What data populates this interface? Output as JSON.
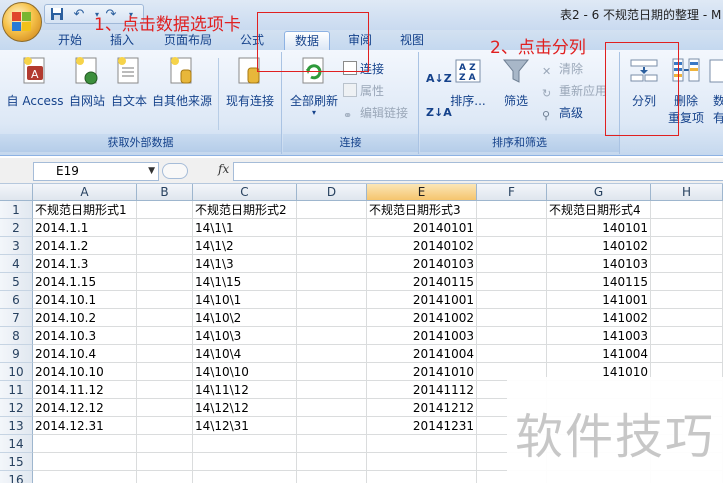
{
  "app": {
    "title": "表2 - 6 不规范日期的整理 - M"
  },
  "quick_access": {
    "icons": [
      "save-icon",
      "undo-icon",
      "redo-icon"
    ]
  },
  "tabs": [
    {
      "label": "开始",
      "active": false
    },
    {
      "label": "插入",
      "active": false
    },
    {
      "label": "页面布局",
      "active": false
    },
    {
      "label": "公式",
      "active": false
    },
    {
      "label": "数据",
      "active": true
    },
    {
      "label": "审阅",
      "active": false
    },
    {
      "label": "视图",
      "active": false
    }
  ],
  "ribbon": {
    "external_data": {
      "label": "获取外部数据",
      "buttons": [
        "自 Access",
        "自网站",
        "自文本",
        "自其他来源",
        "现有连接"
      ]
    },
    "connections": {
      "label": "连接",
      "refresh_all": "全部刷新",
      "small": [
        {
          "label": "连接",
          "enabled": true
        },
        {
          "label": "属性",
          "enabled": false
        },
        {
          "label": "编辑链接",
          "enabled": false
        }
      ]
    },
    "sort_filter": {
      "label": "排序和筛选",
      "sort": "排序...",
      "filter": "筛选",
      "small": [
        {
          "label": "清除",
          "enabled": false
        },
        {
          "label": "重新应用",
          "enabled": false
        },
        {
          "label": "高级",
          "enabled": true
        }
      ]
    },
    "data_tools": {
      "split": "分列",
      "remove_dup_line1": "删除",
      "remove_dup_line2": "重复项",
      "partial_line1": "数",
      "partial_line2": "有"
    }
  },
  "formula_bar": {
    "cell_ref": "E19",
    "fx": "fx",
    "value": ""
  },
  "columns": [
    "A",
    "B",
    "C",
    "D",
    "E",
    "F",
    "G",
    "H"
  ],
  "selected_column": "E",
  "rows": [
    "1",
    "2",
    "3",
    "4",
    "5",
    "6",
    "7",
    "8",
    "9",
    "10",
    "11",
    "12",
    "13",
    "14",
    "15",
    "16"
  ],
  "sheet": {
    "headers": {
      "A": "不规范日期形式1",
      "C": "不规范日期形式2",
      "E": "不规范日期形式3",
      "G": "不规范日期形式4"
    },
    "col_A": [
      "2014.1.1",
      "2014.1.2",
      "2014.1.3",
      "2014.1.15",
      "2014.10.1",
      "2014.10.2",
      "2014.10.3",
      "2014.10.4",
      "2014.10.10",
      "2014.11.12",
      "2014.12.12",
      "2014.12.31"
    ],
    "col_C": [
      "14\\1\\1",
      "14\\1\\2",
      "14\\1\\3",
      "14\\1\\15",
      "14\\10\\1",
      "14\\10\\2",
      "14\\10\\3",
      "14\\10\\4",
      "14\\10\\10",
      "14\\11\\12",
      "14\\12\\12",
      "14\\12\\31"
    ],
    "col_E": [
      "20140101",
      "20140102",
      "20140103",
      "20140115",
      "20141001",
      "20141002",
      "20141003",
      "20141004",
      "20141010",
      "20141112",
      "20141212",
      "20141231"
    ],
    "col_G": [
      "140101",
      "140102",
      "140103",
      "140115",
      "141001",
      "141002",
      "141003",
      "141004",
      "141010"
    ]
  },
  "annotations": {
    "step1": "1、点击数据选项卡",
    "step2": "2、点击分列"
  },
  "watermark": "软件技巧",
  "colors": {
    "accent": "#15428b",
    "annotation": "#e02020",
    "selected_header": "#f5c56e"
  }
}
